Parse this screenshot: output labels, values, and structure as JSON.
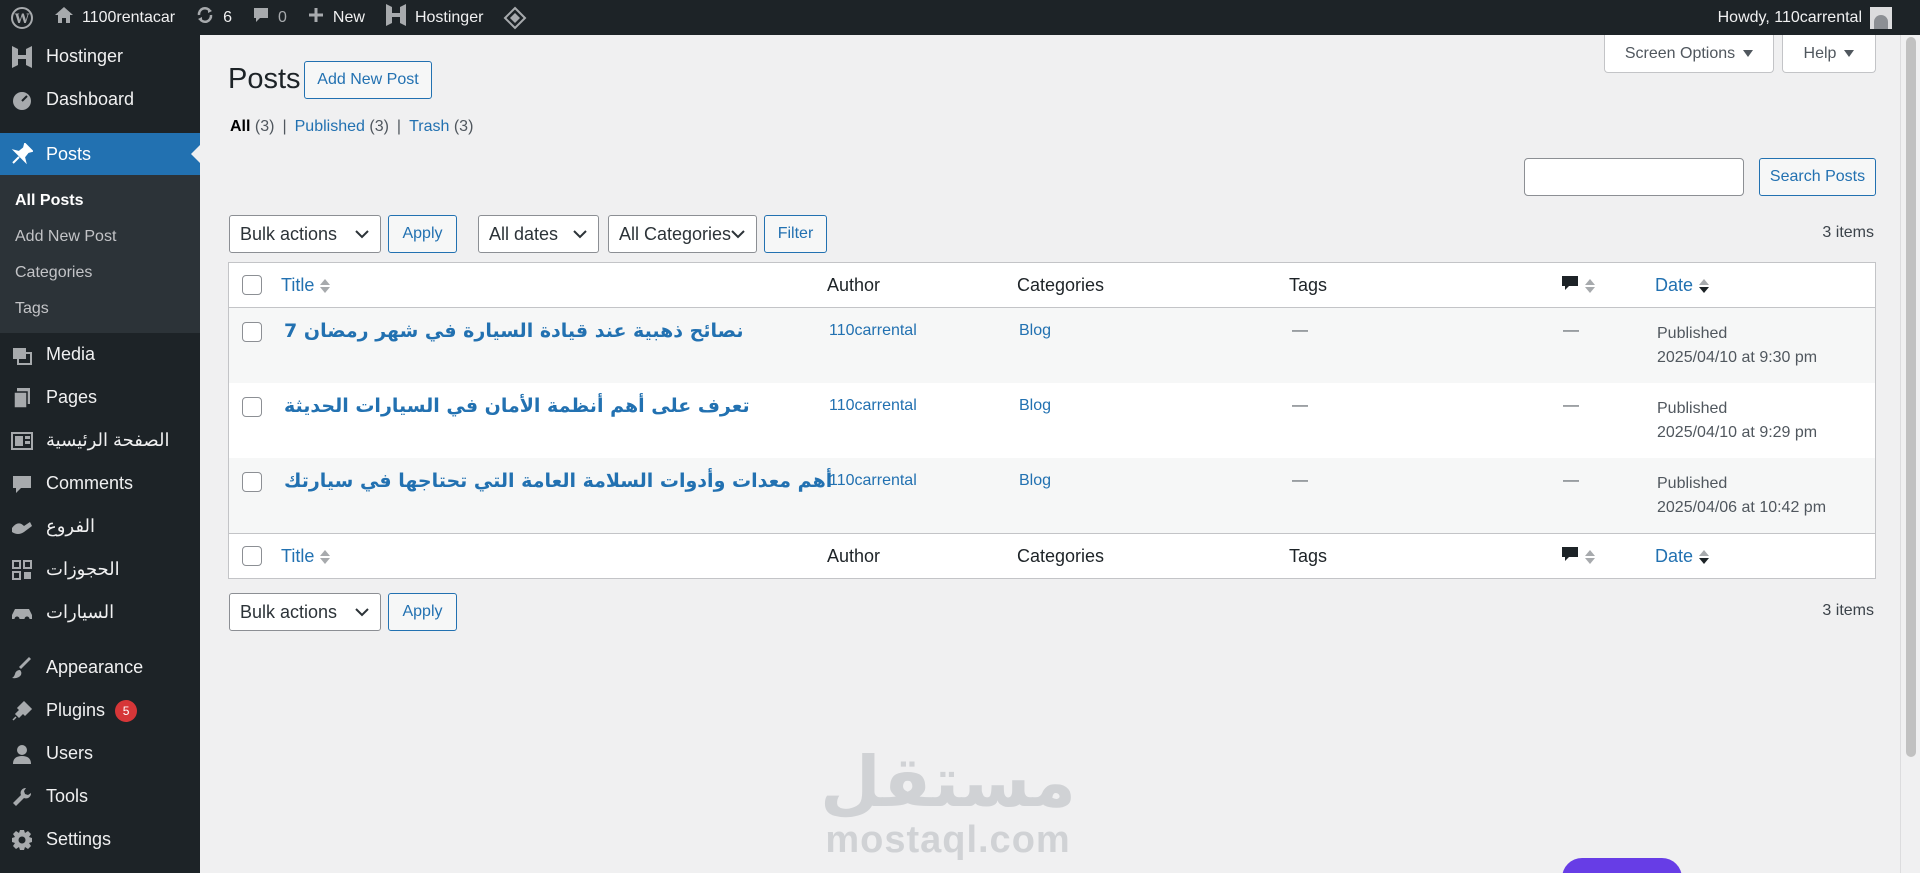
{
  "adminbar": {
    "site_name": "1100rentacar",
    "updates_count": "6",
    "comments_count": "0",
    "new_label": "New",
    "hostinger_label": "Hostinger",
    "howdy": "Howdy, 110carrental"
  },
  "sidebar": {
    "items": [
      {
        "label": "Hostinger",
        "icon": "hostinger-icon"
      },
      {
        "label": "Dashboard",
        "icon": "dashboard-icon"
      },
      {
        "label": "Posts",
        "icon": "pin-icon"
      },
      {
        "label": "Media",
        "icon": "media-icon"
      },
      {
        "label": "Pages",
        "icon": "pages-icon"
      },
      {
        "label": "الصفحة الرئيسية",
        "icon": "home-page-icon"
      },
      {
        "label": "Comments",
        "icon": "comments-icon"
      },
      {
        "label": "الفروع",
        "icon": "branches-icon"
      },
      {
        "label": "الحجوزات",
        "icon": "bookings-icon"
      },
      {
        "label": "السيارات",
        "icon": "cars-icon"
      },
      {
        "label": "Appearance",
        "icon": "appearance-icon"
      },
      {
        "label": "Plugins",
        "icon": "plugins-icon",
        "badge": "5"
      },
      {
        "label": "Users",
        "icon": "users-icon"
      },
      {
        "label": "Tools",
        "icon": "tools-icon"
      },
      {
        "label": "Settings",
        "icon": "settings-icon"
      }
    ],
    "submenu": [
      "All Posts",
      "Add New Post",
      "Categories",
      "Tags"
    ]
  },
  "header": {
    "screen_options": "Screen Options",
    "help": "Help",
    "title": "Posts",
    "add_new": "Add New Post"
  },
  "filters": {
    "all_label": "All",
    "all_count": "(3)",
    "published_label": "Published",
    "published_count": "(3)",
    "trash_label": "Trash",
    "trash_count": "(3)",
    "separator": "|"
  },
  "search": {
    "button": "Search Posts",
    "value": ""
  },
  "tablenav": {
    "bulk_actions": "Bulk actions",
    "apply": "Apply",
    "all_dates": "All dates",
    "all_categories": "All Categories",
    "filter": "Filter",
    "items_count": "3 items"
  },
  "table": {
    "columns": {
      "title": "Title",
      "author": "Author",
      "categories": "Categories",
      "tags": "Tags",
      "date": "Date"
    },
    "rows": [
      {
        "title": "نصائح ذهبية عند قيادة السيارة في شهر رمضان 7",
        "author": "110carrental",
        "category": "Blog",
        "tags": "—",
        "comments": "—",
        "status": "Published",
        "date": "2025/04/10 at 9:30 pm"
      },
      {
        "title": "تعرف على أهم أنظمة الأمان في السيارات الحديثة",
        "author": "110carrental",
        "category": "Blog",
        "tags": "—",
        "comments": "—",
        "status": "Published",
        "date": "2025/04/10 at 9:29 pm"
      },
      {
        "title": "أهم معدات وأدوات السلامة العامة التي تحتاجها في سيارتك",
        "author": "110carrental",
        "category": "Blog",
        "tags": "—",
        "comments": "—",
        "status": "Published",
        "date": "2025/04/06 at 10:42 pm"
      }
    ]
  },
  "watermark": {
    "arabic": "مستقل",
    "latin": "mostaql.com"
  },
  "colors": {
    "accent": "#2271b1",
    "sidebar_bg": "#1d2327",
    "badge": "#d63638"
  }
}
